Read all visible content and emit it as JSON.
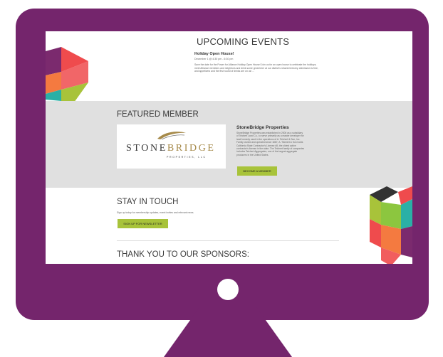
{
  "events": {
    "title": "UPCOMING EVENTS",
    "event_name": "Holiday Open House!",
    "event_date": "December 1 @ 4:30 pm - 6:30 pm",
    "event_description": "Save the date for the Power for Alliance Holiday Open House! Join us for an open house to celebrate the holidays, meet Alliance members and neighbors and drink some great beer at our district's newest brewery. Admission is free, and appetizers and the first round of drinks are on us! ..."
  },
  "featured": {
    "title": "FEATURED MEMBER",
    "logo_text_main": "STONE",
    "logo_text_accent": "BRIDGE",
    "logo_subtext": "PROPERTIES, LLC",
    "member_name": "StoneBridge Properties",
    "member_description": "StoneBridge Properties was established in 2006 as a subsidiary of Teichert Land Co., to serve primarily as a master developer for land formerly used in the operations of A. Teichert & Son, Inc. Family owned and operated since 1887, A. Teichert & Son holds California State Contractor's License #8, the oldest active contractor's license in the state. The Teichert family of companies includes Teichert Aggregates, one of the largest aggregate producers in the United States.",
    "button_label": "BECOME A MEMBER"
  },
  "stay": {
    "title": "STAY IN TOUCH",
    "description": "Sign up today for membership updates, event invites and relevant news.",
    "button_label": "SIGN UP FOR NEWSLETTER"
  },
  "sponsors": {
    "title": "THANK YOU TO OUR SPONSORS:"
  },
  "colors": {
    "frame": "#74256c",
    "accent_green": "#a8c33a",
    "band_gray": "#e0e0e0",
    "hex_red": "#ef4b4d",
    "hex_purple": "#7b2a6e",
    "hex_teal": "#2ab0a6",
    "hex_orange": "#f47a40"
  }
}
